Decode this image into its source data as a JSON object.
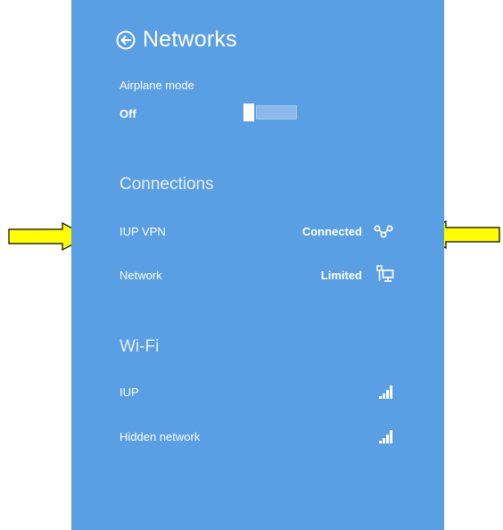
{
  "panel": {
    "title": "Networks",
    "back_icon": "back-arrow-circle-icon",
    "background_color": "#5a9ee3"
  },
  "airplane_mode": {
    "label": "Airplane mode",
    "state": "Off"
  },
  "connections": {
    "title": "Connections",
    "items": [
      {
        "name": "IUP VPN",
        "status": "Connected",
        "icon": "vpn-icon"
      },
      {
        "name": "Network",
        "status": "Limited",
        "icon": "wired-network-icon"
      }
    ]
  },
  "wifi": {
    "title": "Wi-Fi",
    "items": [
      {
        "name": "IUP",
        "icon": "wifi-signal-icon"
      },
      {
        "name": "Hidden network",
        "icon": "wifi-signal-icon"
      }
    ]
  },
  "annotations": {
    "arrow_color": "#ffff00"
  }
}
